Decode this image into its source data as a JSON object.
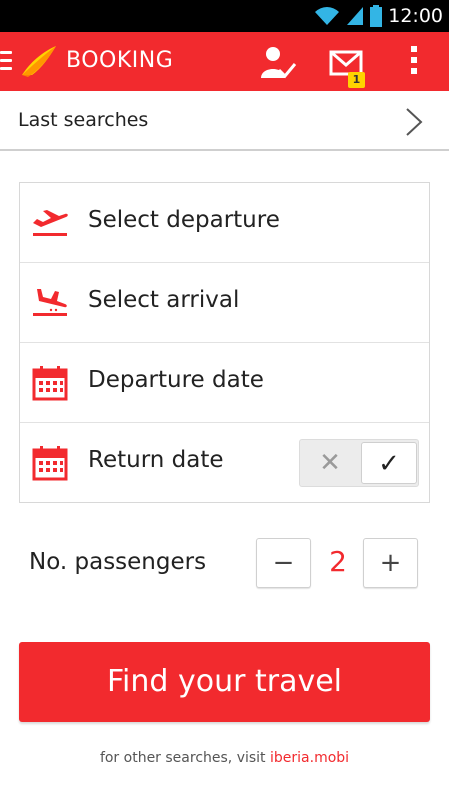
{
  "status_bar": {
    "time": "12:00"
  },
  "app_bar": {
    "title": "BOOKING",
    "mail_badge": "1"
  },
  "last_searches": {
    "label": "Last searches"
  },
  "form": {
    "departure": "Select departure",
    "arrival": "Select arrival",
    "departure_date": "Departure date",
    "return_date": "Return date",
    "return_toggle": {
      "off_symbol": "✕",
      "on_symbol": "✓",
      "selected": "on"
    }
  },
  "passengers": {
    "label": "No. passengers",
    "minus": "−",
    "plus": "+",
    "value": "2"
  },
  "find_button": {
    "label": "Find your travel"
  },
  "footer": {
    "prefix": "for other searches, visit",
    "link": "iberia.mobi"
  },
  "colors": {
    "brand_red": "#f22a2e",
    "badge_yellow": "#ffd400"
  }
}
